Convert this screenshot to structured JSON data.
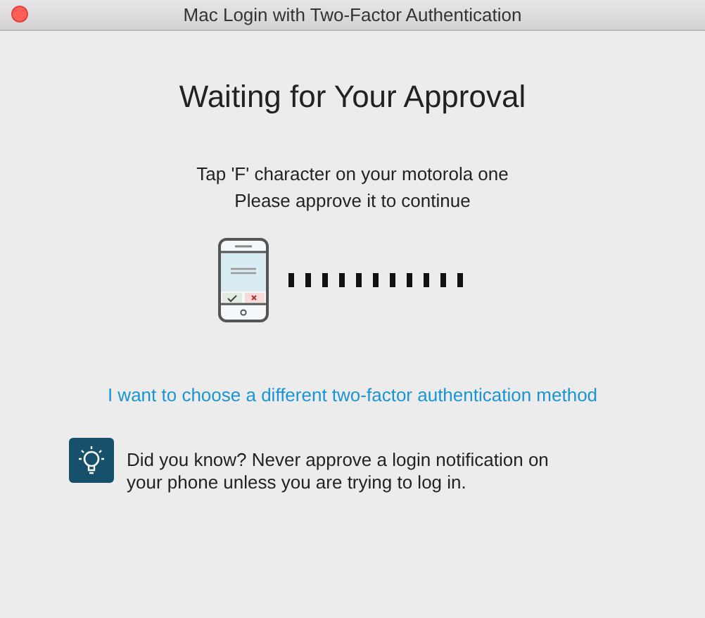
{
  "window": {
    "title": "Mac Login with Two-Factor Authentication"
  },
  "heading": "Waiting for Your Approval",
  "instructions": [
    "Tap 'F' character on your motorola one",
    "Please approve it to continue"
  ],
  "link": "I want to choose a different two-factor authentication method",
  "tip": "Did you know? Never approve a login notification on your phone unless you are trying to log in."
}
